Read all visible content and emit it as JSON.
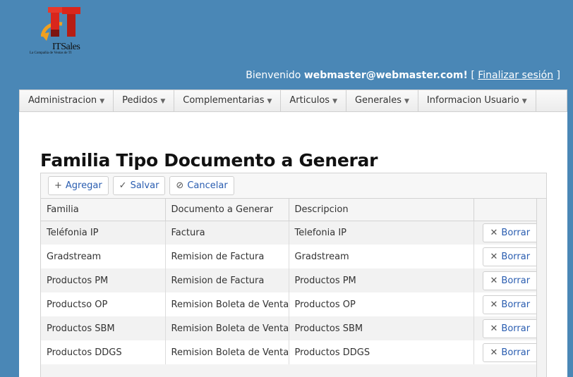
{
  "brand": {
    "logo_text": "ITSales",
    "slogan": "La Compañía de Ventas de TI"
  },
  "header": {
    "welcome_prefix": "Bienvenido",
    "user_email": "webmaster@webmaster.com!",
    "bracket_open": "[",
    "logout_label": "Finalizar sesión",
    "bracket_close": "]"
  },
  "nav": {
    "items": [
      {
        "label": "Administracion"
      },
      {
        "label": "Pedidos"
      },
      {
        "label": "Complementarias"
      },
      {
        "label": "Articulos"
      },
      {
        "label": "Generales"
      },
      {
        "label": "Informacion Usuario"
      }
    ]
  },
  "page": {
    "title": "Familia Tipo Documento a Generar"
  },
  "toolbar": {
    "add_label": "Agregar",
    "save_label": "Salvar",
    "cancel_label": "Cancelar"
  },
  "table": {
    "columns": [
      "Familia",
      "Documento a Generar",
      "Descripcion",
      ""
    ],
    "delete_label": "Borrar",
    "rows": [
      {
        "familia": "Teléfonia IP",
        "documento": "Factura",
        "descripcion": "Telefonia IP"
      },
      {
        "familia": "Gradstream",
        "documento": "Remision de Factura",
        "descripcion": "Gradstream"
      },
      {
        "familia": "Productos PM",
        "documento": "Remision de Factura",
        "descripcion": "Productos PM"
      },
      {
        "familia": "Productso OP",
        "documento": "Remision Boleta de Venta",
        "descripcion": "Productos OP"
      },
      {
        "familia": "Productos SBM",
        "documento": "Remision Boleta de Venta",
        "descripcion": "Productos SBM"
      },
      {
        "familia": "Productos DDGS",
        "documento": "Remision Boleta de Venta",
        "descripcion": "Productos DDGS"
      }
    ]
  },
  "colors": {
    "background": "#4a87b6",
    "link": "#2a5db0",
    "logo_red": "#d9261c",
    "logo_orange": "#f0a020"
  }
}
